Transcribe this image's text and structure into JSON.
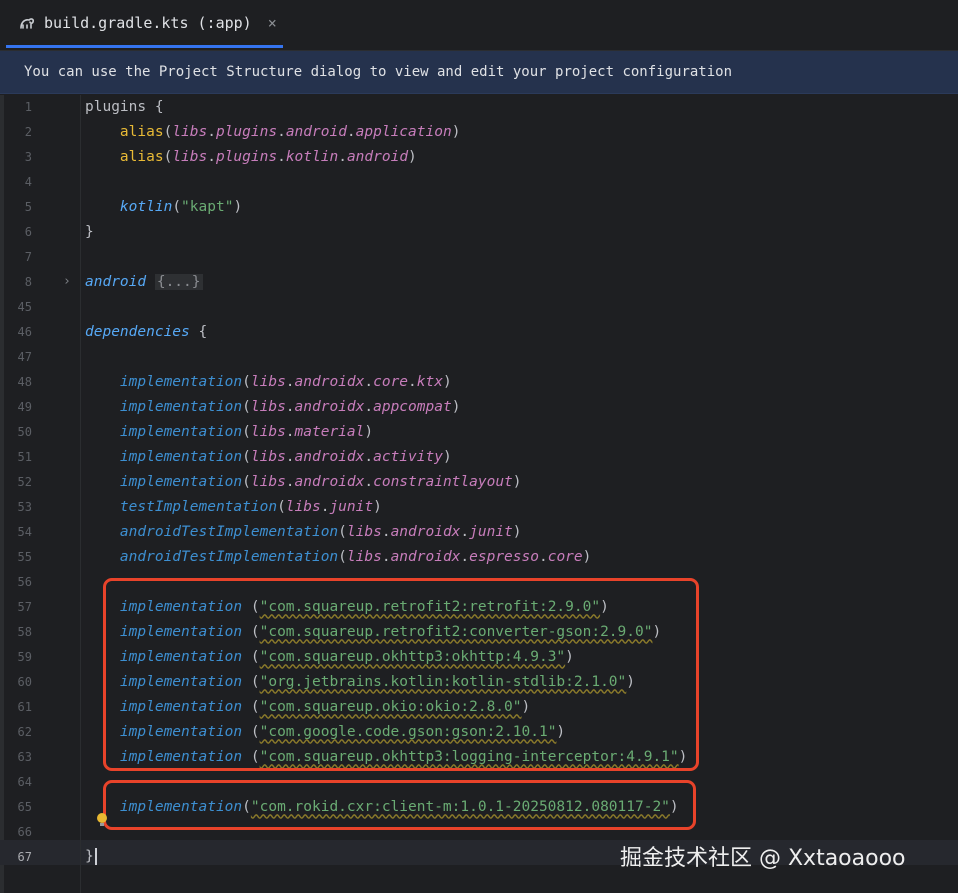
{
  "tab": {
    "title": "build.gradle.kts (:app)",
    "close": "×",
    "icon": "gradle-icon"
  },
  "banner": {
    "text": "You can use the Project Structure dialog to view and edit your project configuration"
  },
  "lines": [
    {
      "num": "1",
      "kind": "plugins"
    },
    {
      "num": "2",
      "fn": "alias",
      "args": [
        [
          "lib",
          "libs"
        ],
        [
          "p",
          "."
        ],
        [
          "lib",
          "plugins"
        ],
        [
          "p",
          "."
        ],
        [
          "lib",
          "android"
        ],
        [
          "p",
          "."
        ],
        [
          "lib",
          "application"
        ]
      ]
    },
    {
      "num": "3",
      "fn": "alias",
      "args": [
        [
          "lib",
          "libs"
        ],
        [
          "p",
          "."
        ],
        [
          "lib",
          "plugins"
        ],
        [
          "p",
          "."
        ],
        [
          "lib",
          "kotlin"
        ],
        [
          "p",
          "."
        ],
        [
          "lib",
          "android"
        ]
      ]
    },
    {
      "num": "4"
    },
    {
      "num": "5",
      "kotlin": "kotlin",
      "kotlin_arg": "\"kapt\""
    },
    {
      "num": "6",
      "text": "}"
    },
    {
      "num": "7"
    },
    {
      "num": "8",
      "android": "android",
      "folded": "{...}"
    },
    {
      "num": "45"
    },
    {
      "num": "46",
      "deps": "dependencies",
      "brace": "{"
    },
    {
      "num": "47"
    },
    {
      "num": "48",
      "impl": "implementation",
      "lib": [
        "libs",
        "androidx",
        "core",
        "ktx"
      ]
    },
    {
      "num": "49",
      "impl": "implementation",
      "lib": [
        "libs",
        "androidx",
        "appcompat"
      ]
    },
    {
      "num": "50",
      "impl": "implementation",
      "lib": [
        "libs",
        "material"
      ]
    },
    {
      "num": "51",
      "impl": "implementation",
      "lib": [
        "libs",
        "androidx",
        "activity"
      ]
    },
    {
      "num": "52",
      "impl": "implementation",
      "lib": [
        "libs",
        "androidx",
        "constraintlayout"
      ]
    },
    {
      "num": "53",
      "impl": "testImplementation",
      "lib": [
        "libs",
        "junit"
      ]
    },
    {
      "num": "54",
      "impl": "androidTestImplementation",
      "lib": [
        "libs",
        "androidx",
        "junit"
      ]
    },
    {
      "num": "55",
      "impl": "androidTestImplementation",
      "lib": [
        "libs",
        "androidx",
        "espresso",
        "core"
      ]
    },
    {
      "num": "56"
    },
    {
      "num": "57",
      "impl": "implementation",
      "dep": "\"com.squareup.retrofit2:retrofit:2.9.0\""
    },
    {
      "num": "58",
      "impl": "implementation",
      "dep": "\"com.squareup.retrofit2:converter-gson:2.9.0\""
    },
    {
      "num": "59",
      "impl": "implementation",
      "dep": "\"com.squareup.okhttp3:okhttp:4.9.3\""
    },
    {
      "num": "60",
      "impl": "implementation",
      "dep": "\"org.jetbrains.kotlin:kotlin-stdlib:2.1.0\""
    },
    {
      "num": "61",
      "impl": "implementation",
      "dep": "\"com.squareup.okio:okio:2.8.0\""
    },
    {
      "num": "62",
      "impl": "implementation",
      "dep": "\"com.google.code.gson:gson:2.10.1\""
    },
    {
      "num": "63",
      "impl": "implementation",
      "dep": "\"com.squareup.okhttp3:logging-interceptor:4.9.1\""
    },
    {
      "num": "64"
    },
    {
      "num": "65",
      "impl": "implementation",
      "dep_tight": "\"com.rokid.cxr:client-m:1.0.1-20250812.080117-2\""
    },
    {
      "num": "66"
    },
    {
      "num": "67",
      "text": "}",
      "current": true
    }
  ],
  "watermark": "掘金技术社区 @ Xxtaoaooo",
  "colors": {
    "highlight_box": "#e8432a",
    "accent_tab": "#3574f0"
  }
}
